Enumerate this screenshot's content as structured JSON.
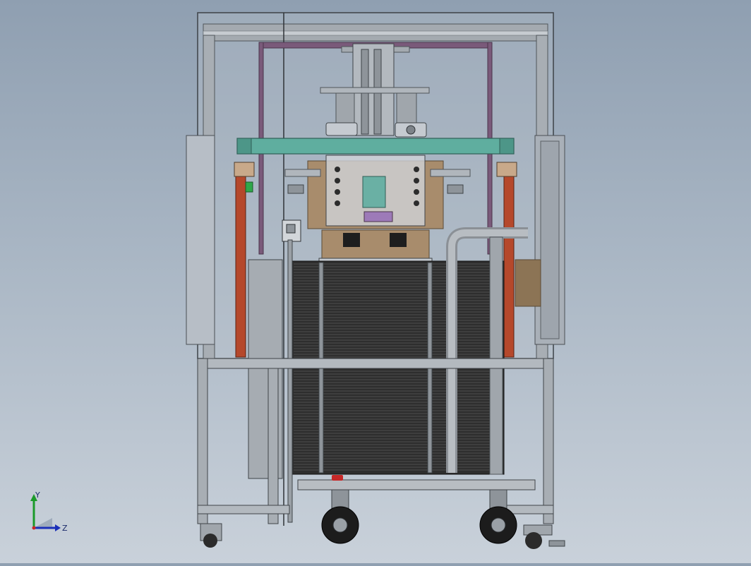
{
  "viewport": {
    "background_top": "#8f9fb1",
    "background_bottom": "#c9d1da"
  },
  "model": {
    "frame_color": "#9aa0a6",
    "frame_dark": "#5c6166",
    "glass_color": "#b9c2cc",
    "beam_color": "#5fae9f",
    "column_color": "#b5482b",
    "violet_frame_color": "#7a5a7a",
    "cardboard_color": "#a88c6c",
    "stack_color": "#2e2e2e",
    "wheel_color": "#1c1c1c"
  },
  "triad": {
    "y_label": "Y",
    "z_label": "Z",
    "y_color": "#1b9a2a",
    "z_color": "#1a2fb8",
    "x_color": "#c62828"
  }
}
